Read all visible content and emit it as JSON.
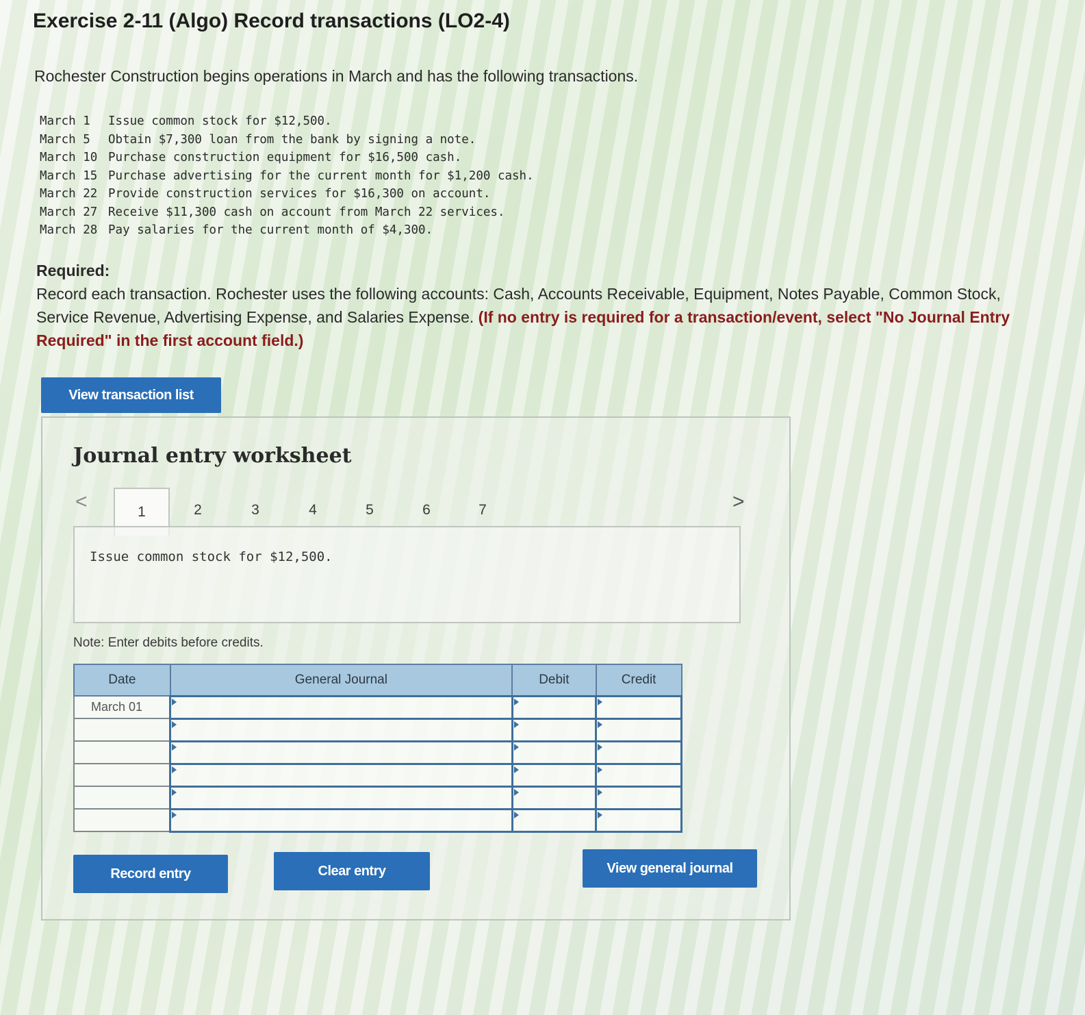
{
  "title": "Exercise 2-11 (Algo) Record transactions (LO2-4)",
  "intro": "Rochester Construction begins operations in March and has the following transactions.",
  "transactions": [
    {
      "date": "March 1",
      "text": "Issue common stock for $12,500."
    },
    {
      "date": "March 5",
      "text": "Obtain $7,300 loan from the bank by signing a note."
    },
    {
      "date": "March 10",
      "text": "Purchase construction equipment for $16,500 cash."
    },
    {
      "date": "March 15",
      "text": "Purchase advertising for the current month for $1,200 cash."
    },
    {
      "date": "March 22",
      "text": "Provide construction services for $16,300 on account."
    },
    {
      "date": "March 27",
      "text": "Receive $11,300 cash on account from March 22 services."
    },
    {
      "date": "March 28",
      "text": "Pay salaries for the current month of $4,300."
    }
  ],
  "required": {
    "label": "Required:",
    "text": "Record each transaction. Rochester uses the following accounts: Cash, Accounts Receivable, Equipment, Notes Payable, Common Stock, Service Revenue, Advertising Expense, and Salaries Expense. ",
    "note": "(If no entry is required for a transaction/event, select \"No Journal Entry Required\" in the first account field.)"
  },
  "buttons": {
    "view_transaction_list": "View transaction list",
    "record_entry": "Record entry",
    "clear_entry": "Clear entry",
    "view_general_journal": "View general journal"
  },
  "worksheet": {
    "title": "Journal entry worksheet",
    "tabs": [
      "1",
      "2",
      "3",
      "4",
      "5",
      "6",
      "7"
    ],
    "active_tab": "1",
    "prev_icon": "<",
    "next_icon": ">",
    "description": "Issue common stock for $12,500.",
    "note": "Note: Enter debits before credits.",
    "columns": [
      "Date",
      "General Journal",
      "Debit",
      "Credit"
    ],
    "rows": [
      {
        "date": "March 01",
        "account": "",
        "debit": "",
        "credit": ""
      },
      {
        "date": "",
        "account": "",
        "debit": "",
        "credit": ""
      },
      {
        "date": "",
        "account": "",
        "debit": "",
        "credit": ""
      },
      {
        "date": "",
        "account": "",
        "debit": "",
        "credit": ""
      },
      {
        "date": "",
        "account": "",
        "debit": "",
        "credit": ""
      },
      {
        "date": "",
        "account": "",
        "debit": "",
        "credit": ""
      }
    ]
  },
  "colors": {
    "button_blue": "#2a6fb8",
    "header_blue": "#a8c8df",
    "required_note_red": "#8a1c1c"
  }
}
